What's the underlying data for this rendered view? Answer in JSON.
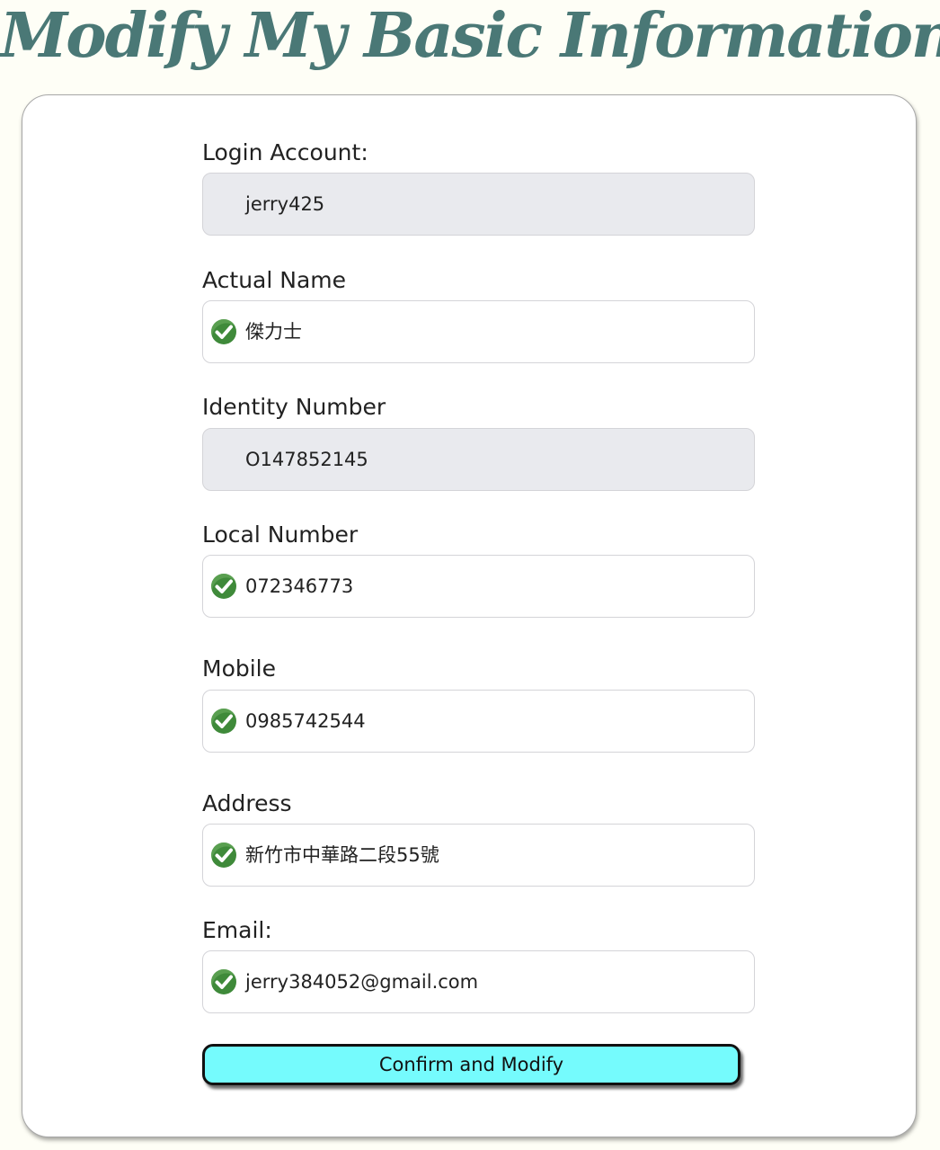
{
  "page": {
    "title": "Modify My Basic Information"
  },
  "colors": {
    "title": "#4a7876",
    "background": "#fefef6",
    "readonly_field": "#e9eaee",
    "button": "#75fbfd",
    "check": "#3f8a3a"
  },
  "form": {
    "fields": [
      {
        "label": "Login Account:",
        "value": "jerry425",
        "readonly": true,
        "validated": false
      },
      {
        "label": "Actual Name",
        "value": "傑力士",
        "readonly": false,
        "validated": true
      },
      {
        "label": "Identity Number",
        "value": "O147852145",
        "readonly": true,
        "validated": false
      },
      {
        "label": "Local Number",
        "value": "072346773",
        "readonly": false,
        "validated": true
      },
      {
        "label": "Mobile",
        "value": "0985742544",
        "readonly": false,
        "validated": true
      },
      {
        "label": "Address",
        "value": "新竹市中華路二段55號",
        "readonly": false,
        "validated": true
      },
      {
        "label": "Email:",
        "value": "jerry384052@gmail.com",
        "readonly": false,
        "validated": true
      }
    ],
    "submit_label": "Confirm and Modify"
  },
  "icons": {
    "validated": "check-circle-icon"
  }
}
